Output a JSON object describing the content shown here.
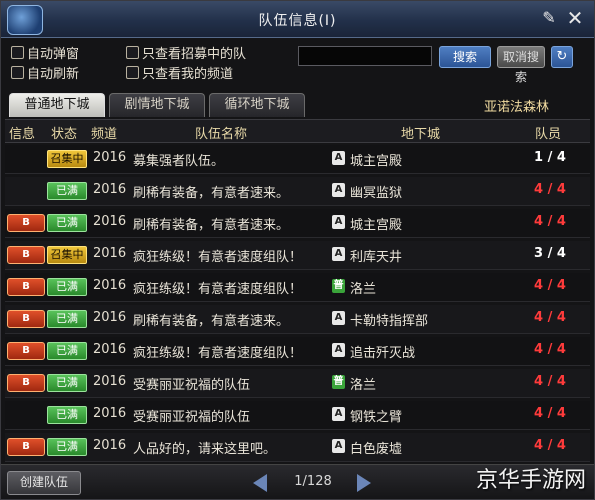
{
  "window": {
    "title": "队伍信息(I)"
  },
  "filters": {
    "auto_refuse": "自动弹窗",
    "auto_refresh": "自动刷新",
    "only_recruiting": "只查看招募中的队",
    "only_my_channel": "只查看我的频道"
  },
  "search": {
    "value": "",
    "search_label": "搜索",
    "cancel_label": "取消搜索",
    "refresh_icon": "refresh-icon"
  },
  "tabs": [
    {
      "label": "普通地下城",
      "active": true
    },
    {
      "label": "剧情地下城",
      "active": false
    },
    {
      "label": "循环地下城",
      "active": false
    }
  ],
  "region": "亚诺法森林",
  "headers": {
    "info": "信息",
    "status": "状态",
    "channel": "频道",
    "team": "队伍名称",
    "dungeon": "地下城",
    "members": "队员"
  },
  "rows": [
    {
      "info": "",
      "status": "召集中",
      "status_type": "recruit",
      "channel": "2016",
      "team": "募集强者队伍。",
      "dg_type": "A",
      "dungeon": "城主宫殿",
      "members": "1 / 4",
      "full": false
    },
    {
      "info": "",
      "status": "已满",
      "status_type": "full",
      "channel": "2016",
      "team": "刷稀有装备，有意者速来。",
      "dg_type": "A",
      "dungeon": "幽冥监狱",
      "members": "4 / 4",
      "full": true
    },
    {
      "info": "B",
      "status": "已满",
      "status_type": "full",
      "channel": "2016",
      "team": "刷稀有装备，有意者速来。",
      "dg_type": "A",
      "dungeon": "城主宫殿",
      "members": "4 / 4",
      "full": true
    },
    {
      "info": "B",
      "status": "召集中",
      "status_type": "recruit",
      "channel": "2016",
      "team": "疯狂练级！有意者速度组队！",
      "dg_type": "A",
      "dungeon": "利库天井",
      "members": "3 / 4",
      "full": false
    },
    {
      "info": "B",
      "status": "已满",
      "status_type": "full",
      "channel": "2016",
      "team": "疯狂练级！有意者速度组队！",
      "dg_type": "普",
      "dungeon": "洛兰",
      "members": "4 / 4",
      "full": true
    },
    {
      "info": "B",
      "status": "已满",
      "status_type": "full",
      "channel": "2016",
      "team": "刷稀有装备，有意者速来。",
      "dg_type": "A",
      "dungeon": "卡勒特指挥部",
      "members": "4 / 4",
      "full": true
    },
    {
      "info": "B",
      "status": "已满",
      "status_type": "full",
      "channel": "2016",
      "team": "疯狂练级！有意者速度组队！",
      "dg_type": "A",
      "dungeon": "追击歼灭战",
      "members": "4 / 4",
      "full": true
    },
    {
      "info": "B",
      "status": "已满",
      "status_type": "full",
      "channel": "2016",
      "team": "受赛丽亚祝福的队伍",
      "dg_type": "普",
      "dungeon": "洛兰",
      "members": "4 / 4",
      "full": true
    },
    {
      "info": "",
      "status": "已满",
      "status_type": "full",
      "channel": "2016",
      "team": "受赛丽亚祝福的队伍",
      "dg_type": "A",
      "dungeon": "钢铁之臂",
      "members": "4 / 4",
      "full": true
    },
    {
      "info": "B",
      "status": "已满",
      "status_type": "full",
      "channel": "2016",
      "team": "人品好的，请来这里吧。",
      "dg_type": "A",
      "dungeon": "白色废墟",
      "members": "4 / 4",
      "full": true
    }
  ],
  "footer": {
    "create_label": "创建队伍",
    "page": "1/128"
  },
  "watermark": "京华手游网"
}
